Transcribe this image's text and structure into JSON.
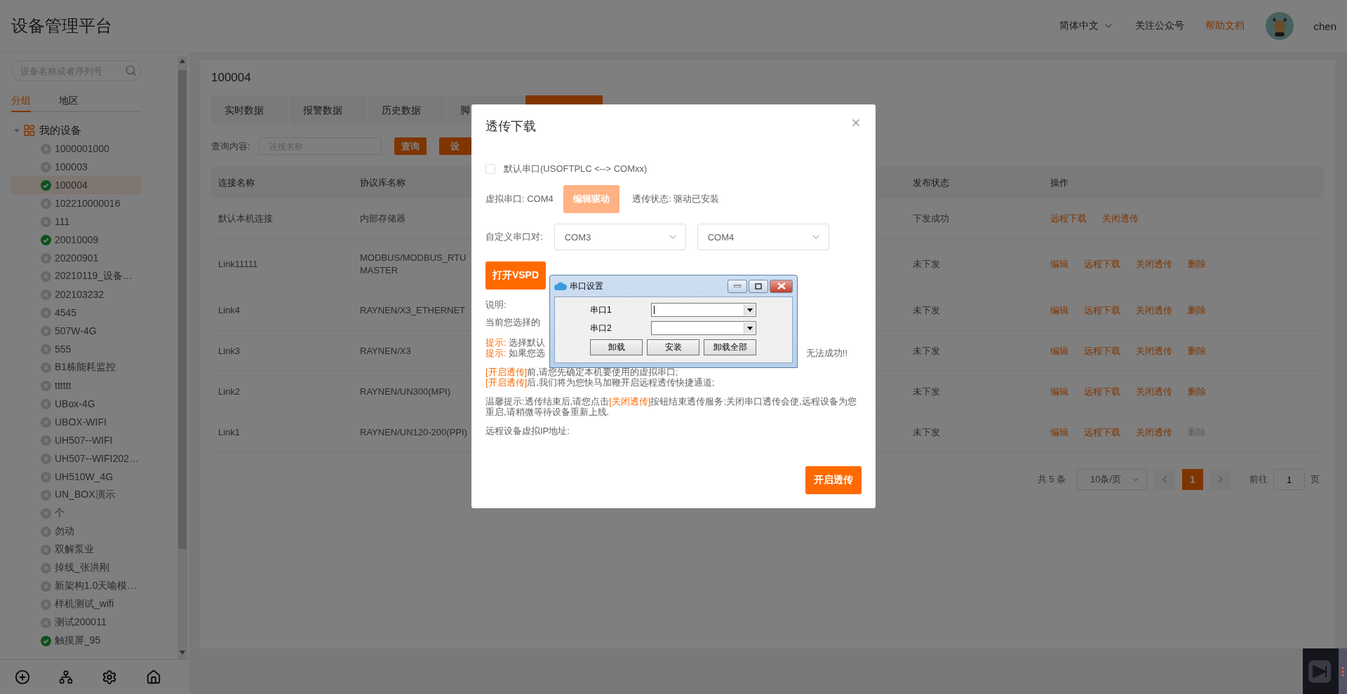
{
  "header": {
    "title": "设备管理平台",
    "language": "简体中文",
    "links": [
      {
        "label": "关注公众号",
        "highlight": false
      },
      {
        "label": "帮助文档",
        "highlight": true
      }
    ],
    "user": "chen"
  },
  "sidebar": {
    "search": {
      "placeholder": "设备名称或者序列号"
    },
    "tabs": [
      {
        "label": "分组",
        "selected": true
      },
      {
        "label": "地区",
        "selected": false
      }
    ],
    "tree": [
      {
        "label": "我的设备",
        "expanded": true,
        "children": [
          {
            "label": "1000001000",
            "online": false,
            "selected": false
          },
          {
            "label": "100003",
            "online": false,
            "selected": false
          },
          {
            "label": "100004",
            "online": true,
            "selected": true
          },
          {
            "label": "102210000016",
            "online": false,
            "selected": false
          },
          {
            "label": "111",
            "online": false,
            "selected": false
          },
          {
            "label": "20010009",
            "online": true,
            "selected": false
          },
          {
            "label": "20200901",
            "online": false,
            "selected": false
          },
          {
            "label": "20210119_设备…",
            "online": false,
            "selected": false
          },
          {
            "label": "202103232",
            "online": false,
            "selected": false
          },
          {
            "label": "4545",
            "online": false,
            "selected": false
          },
          {
            "label": "507W-4G",
            "online": false,
            "selected": false
          },
          {
            "label": "555",
            "online": false,
            "selected": false
          },
          {
            "label": "B1栋能耗监控",
            "online": false,
            "selected": false
          },
          {
            "label": "tttttt",
            "online": false,
            "selected": false
          },
          {
            "label": "UBox-4G",
            "online": false,
            "selected": false
          },
          {
            "label": "UBOX-WIFI",
            "online": false,
            "selected": false
          },
          {
            "label": "UH507--WIFI",
            "online": false,
            "selected": false
          },
          {
            "label": "UH507--WIFI202…",
            "online": false,
            "selected": false
          },
          {
            "label": "UH510W_4G",
            "online": false,
            "selected": false
          },
          {
            "label": "UN_BOX演示",
            "online": false,
            "selected": false
          },
          {
            "label": "个",
            "online": false,
            "selected": false
          },
          {
            "label": "勿动",
            "online": false,
            "selected": false
          },
          {
            "label": "双解泵业",
            "online": false,
            "selected": false
          },
          {
            "label": "掉线_张洪刚",
            "online": false,
            "selected": false
          },
          {
            "label": "新架构1.0天喻模…",
            "online": false,
            "selected": false
          },
          {
            "label": "样机测试_wifi",
            "online": false,
            "selected": false
          },
          {
            "label": "测试200011",
            "online": false,
            "selected": false
          },
          {
            "label": "触摸屏_95",
            "online": true,
            "selected": false
          }
        ]
      }
    ]
  },
  "device": {
    "title": "100004",
    "tabs": [
      {
        "label": "实时数据",
        "selected": false
      },
      {
        "label": "报警数据",
        "selected": false
      },
      {
        "label": "历史数据",
        "selected": false
      },
      {
        "label": "脚",
        "selected": false
      },
      {
        "selected": true
      }
    ],
    "query": {
      "label": "查询内容:",
      "placeholder": "连接名称",
      "buttons": [
        "查询",
        "设"
      ]
    },
    "table": {
      "columns": [
        "连接名称",
        "协议库名称",
        "发布状态",
        "操作"
      ],
      "rows": [
        {
          "cells": [
            "默认本机连接",
            "内部存储器",
            "下发成功"
          ],
          "actions": [
            {
              "label": "远程下载",
              "disabled": false
            },
            {
              "label": "关闭透传",
              "disabled": false
            }
          ]
        },
        {
          "cells": [
            "Link11111",
            "MODBUS/MODBUS_RTU MASTER",
            "未下发"
          ],
          "actions": [
            {
              "label": "编辑",
              "disabled": false
            },
            {
              "label": "远程下载",
              "disabled": false
            },
            {
              "label": "关闭透传",
              "disabled": false
            },
            {
              "label": "删除",
              "disabled": false
            }
          ]
        },
        {
          "cells": [
            "Link4",
            "RAYNEN/X3_ETHERNET",
            "未下发"
          ],
          "actions": [
            {
              "label": "编辑",
              "disabled": false
            },
            {
              "label": "远程下载",
              "disabled": false
            },
            {
              "label": "关闭透传",
              "disabled": false
            },
            {
              "label": "删除",
              "disabled": false
            }
          ]
        },
        {
          "cells": [
            "Link3",
            "RAYNEN/X3",
            "未下发"
          ],
          "actions": [
            {
              "label": "编辑",
              "disabled": false
            },
            {
              "label": "远程下载",
              "disabled": false
            },
            {
              "label": "关闭透传",
              "disabled": false
            },
            {
              "label": "删除",
              "disabled": false
            }
          ]
        },
        {
          "cells": [
            "Link2",
            "RAYNEN/UN300(MPI)",
            "未下发"
          ],
          "actions": [
            {
              "label": "编辑",
              "disabled": false
            },
            {
              "label": "远程下载",
              "disabled": false
            },
            {
              "label": "关闭透传",
              "disabled": false
            },
            {
              "label": "删除",
              "disabled": false
            }
          ]
        },
        {
          "cells": [
            "Link1",
            "RAYNEN/UN120-200(PPI)",
            "未下发"
          ],
          "actions": [
            {
              "label": "编辑",
              "disabled": false
            },
            {
              "label": "远程下载",
              "disabled": false
            },
            {
              "label": "关闭透传",
              "disabled": false
            },
            {
              "label": "删除",
              "disabled": true
            }
          ]
        }
      ]
    },
    "pagination": {
      "total": "共 5 条",
      "page_size": "10条/页",
      "pages": [
        {
          "label": "1",
          "selected": true
        }
      ],
      "goto_label": "前往",
      "goto_value": "1",
      "goto_suffix": "页"
    }
  },
  "modal": {
    "title": "透传下载",
    "default_port": {
      "label": "默认串口(USOFTPLC <--> COMxx)",
      "checked": false
    },
    "virtual_port": "虚拟串口: COM4",
    "edit_driver": {
      "label": "编辑驱动",
      "disabled": true
    },
    "status": "透传状态: 驱动已安装",
    "pair_label": "自定义串口对:",
    "pair": [
      {
        "value": "COM3"
      },
      {
        "value": "COM4"
      }
    ],
    "open_vspd": "打开VSPD",
    "notes": [
      {
        "lines": [
          {
            "parts": [
              {
                "text": "说明:",
                "em": false
              }
            ]
          }
        ]
      },
      {
        "lines": [
          {
            "parts": [
              {
                "text": "当前您选择的",
                "em": false
              }
            ]
          }
        ]
      },
      {
        "lines": [
          {
            "parts": [
              {
                "text": "提示:",
                "em": true
              },
              {
                "text": " 选择默认",
                "em": false
              }
            ]
          },
          {
            "parts": [
              {
                "text": "提示:",
                "em": true
              },
              {
                "text": " 如果您选",
                "em": false
              }
            ],
            "tail": "无法成功!!"
          }
        ]
      },
      {
        "lines": [
          {
            "parts": [
              {
                "text": "[开启透传]",
                "em": true
              },
              {
                "text": "前,请您先确定本机要使用的虚拟串口;",
                "em": false
              }
            ]
          },
          {
            "parts": [
              {
                "text": "[开启透传]",
                "em": true
              },
              {
                "text": "后,我们将为您快马加鞭开启远程透传快捷通道;",
                "em": false
              }
            ]
          }
        ]
      },
      {
        "lines": [
          {
            "parts": [
              {
                "text": "温馨提示:透传结束后,请您点击",
                "em": false
              },
              {
                "text": "[关闭透传]",
                "em": true
              },
              {
                "text": "按钮结束透传服务;关闭串口透传会使,远程设备为您重启,请稍微等待设备重新上线.",
                "em": false
              }
            ]
          }
        ]
      },
      {
        "lines": [
          {
            "parts": [
              {
                "text": "远程设备虚拟IP地址:",
                "em": false
              }
            ]
          }
        ]
      }
    ],
    "submit": "开启透传"
  },
  "port_dialog": {
    "title": "串口设置",
    "fields": [
      {
        "label": "串口1",
        "focused": true
      },
      {
        "label": "串口2",
        "focused": false
      }
    ],
    "buttons": [
      "卸载",
      "安装",
      "卸载全部"
    ]
  }
}
